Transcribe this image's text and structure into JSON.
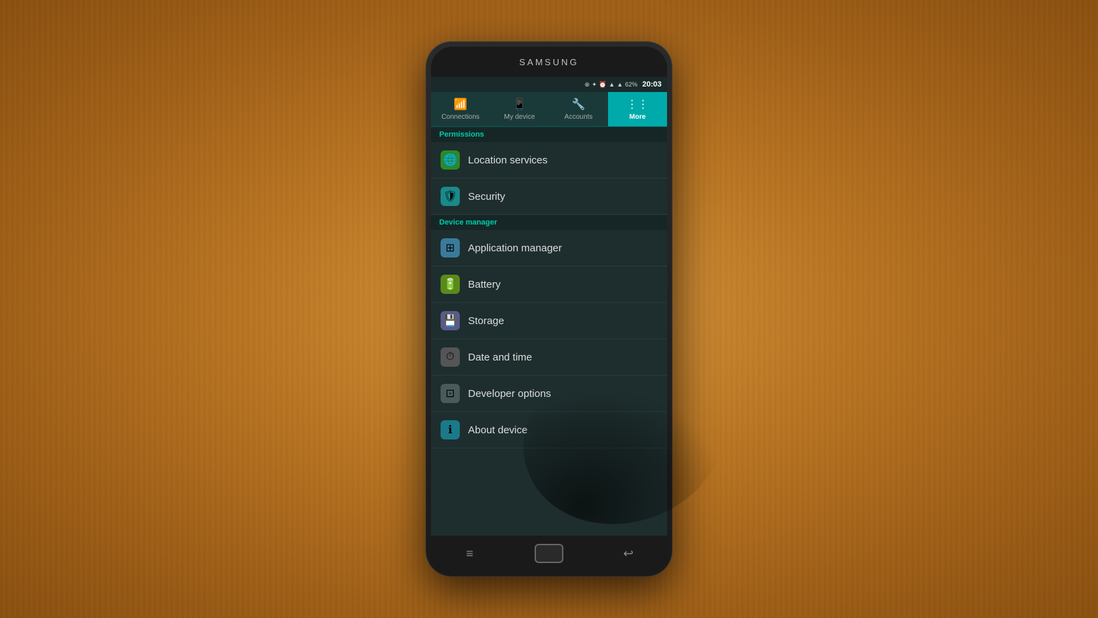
{
  "phone": {
    "brand": "SAMSUNG",
    "status_bar": {
      "time": "20:03",
      "battery": "62%",
      "icons": [
        "⊕",
        "✦",
        "⏰",
        "▲",
        "▌▌"
      ]
    },
    "tabs": [
      {
        "id": "connections",
        "label": "Connections",
        "icon": "📶",
        "active": false
      },
      {
        "id": "my_device",
        "label": "My device",
        "icon": "📱",
        "active": false
      },
      {
        "id": "accounts",
        "label": "Accounts",
        "icon": "🔧",
        "active": false
      },
      {
        "id": "more",
        "label": "More",
        "icon": "⋮⋮",
        "active": true
      }
    ],
    "sections": [
      {
        "id": "permissions",
        "header": "Permissions",
        "items": [
          {
            "id": "location",
            "label": "Location services",
            "icon": "🌐",
            "icon_class": "green"
          },
          {
            "id": "security",
            "label": "Security",
            "icon": "🛡",
            "icon_class": "teal"
          }
        ]
      },
      {
        "id": "device_manager",
        "header": "Device manager",
        "items": [
          {
            "id": "app_manager",
            "label": "Application manager",
            "icon": "⊞",
            "icon_class": "grid"
          },
          {
            "id": "battery",
            "label": "Battery",
            "icon": "🔋",
            "icon_class": "yellow-green"
          },
          {
            "id": "storage",
            "label": "Storage",
            "icon": "💾",
            "icon_class": "storage-ic"
          },
          {
            "id": "date_time",
            "label": "Date and time",
            "icon": "⏱",
            "icon_class": "gray"
          },
          {
            "id": "developer",
            "label": "Developer options",
            "icon": "⊡",
            "icon_class": "dev"
          },
          {
            "id": "about",
            "label": "About device",
            "icon": "ℹ",
            "icon_class": "about"
          }
        ]
      }
    ],
    "nav": {
      "menu": "≡",
      "home": "",
      "back": "↩"
    }
  }
}
